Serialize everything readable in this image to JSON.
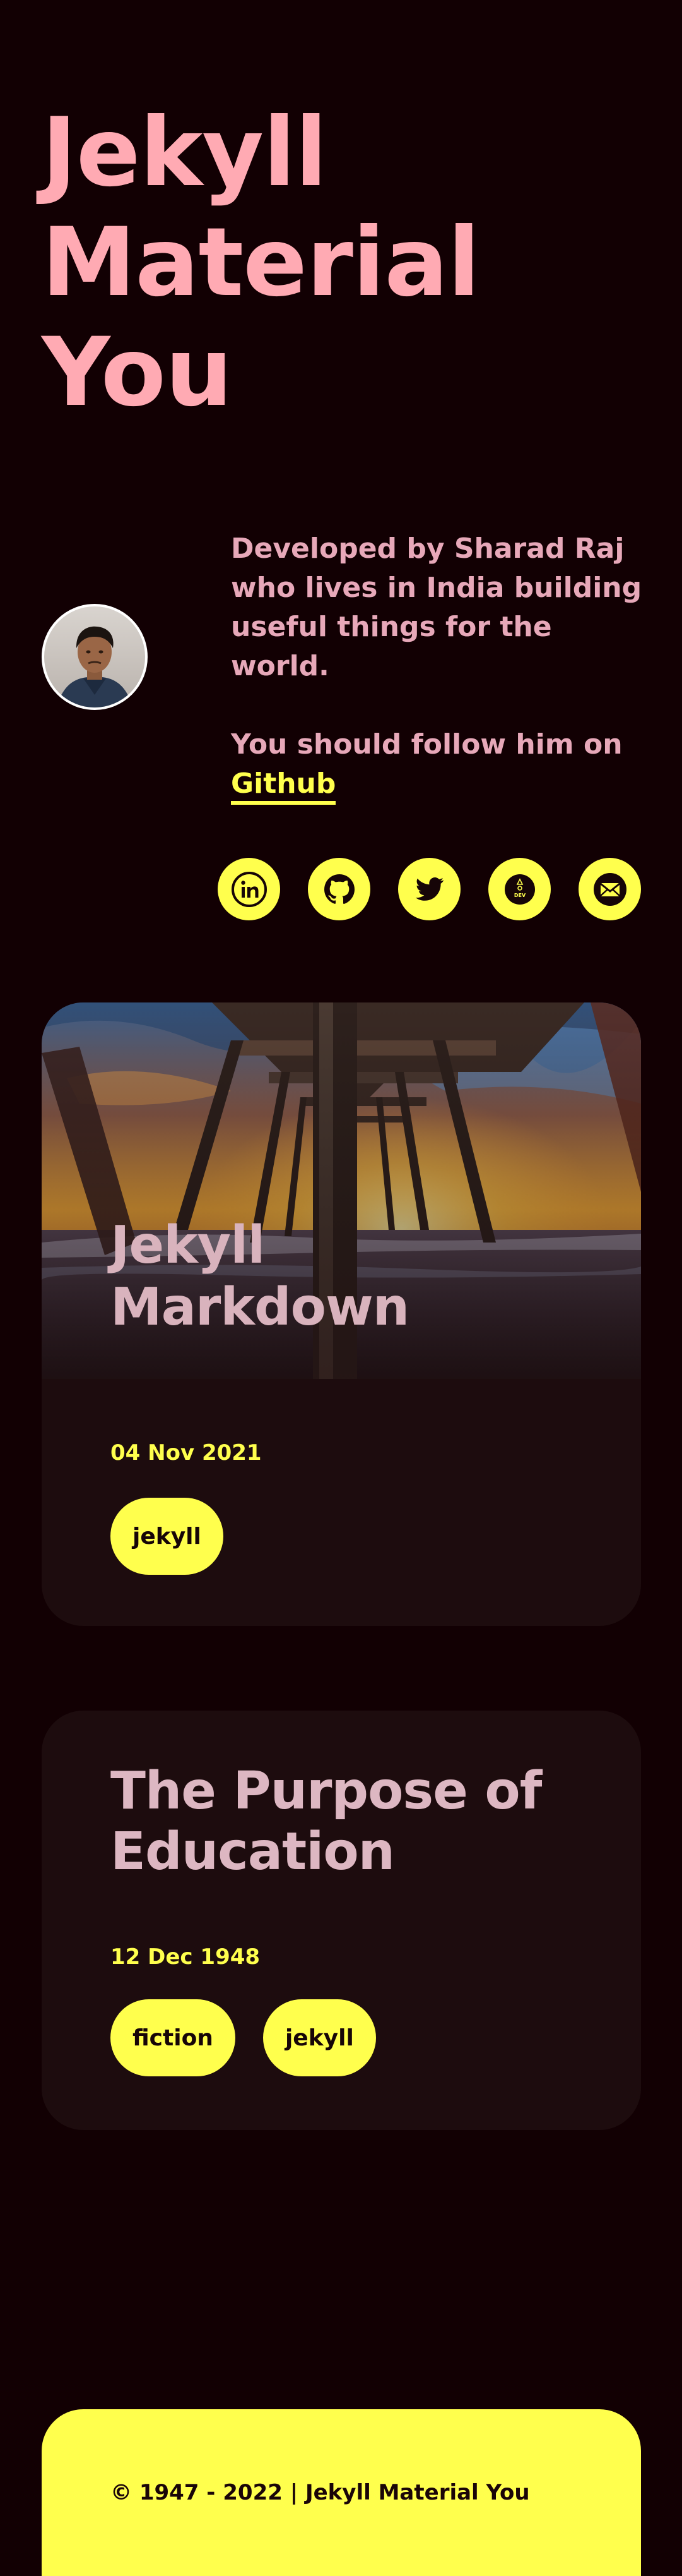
{
  "header": {
    "title_line1": "Jekyll",
    "title_line2": "Material",
    "title_line3": "You"
  },
  "author": {
    "avatar_icon": "person-avatar",
    "bio": "Developed by Sharad Raj who lives in India building useful things for the world.",
    "follow_text": "You should follow him on ",
    "follow_link": "Github"
  },
  "social": [
    {
      "icon": "linkedin-icon"
    },
    {
      "icon": "github-icon"
    },
    {
      "icon": "twitter-icon"
    },
    {
      "icon": "dev-icon",
      "label": "DEV"
    },
    {
      "icon": "mail-icon"
    }
  ],
  "posts": [
    {
      "title_line1": "Jekyll",
      "title_line2": "Markdown",
      "date": "04 Nov 2021",
      "tags": [
        "jekyll"
      ]
    },
    {
      "title_line1": "The Purpose of",
      "title_line2": "Education",
      "date": "12 Dec 1948",
      "tags": [
        "fiction",
        "jekyll"
      ]
    }
  ],
  "footer": {
    "text": "© 1947 - 2022 | Jekyll Material You"
  },
  "colors": {
    "background": "#120003",
    "title": "#ffaab3",
    "accent": "#ffff4d",
    "card": "#1d0c0e",
    "text": "#e7a8b9"
  }
}
